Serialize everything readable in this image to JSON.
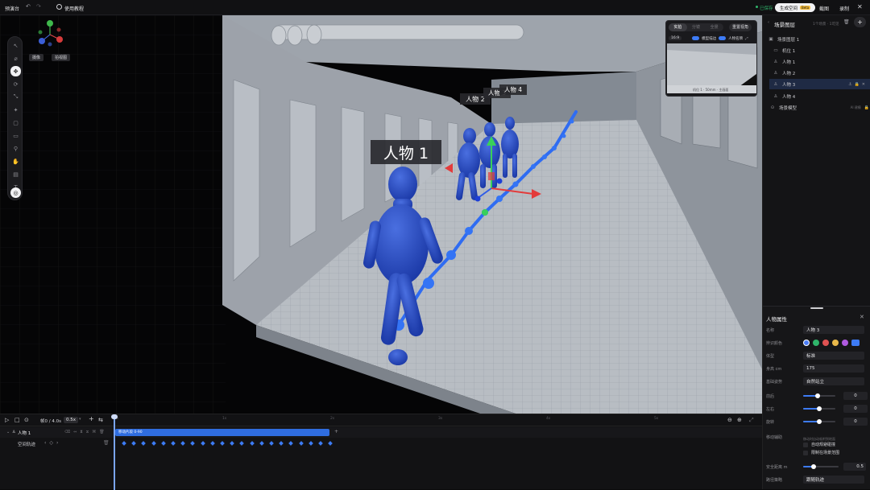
{
  "topbar": {
    "title": "预演台",
    "tutorial": "使用教程",
    "saved": "已保存",
    "gen_space": "生成空间",
    "beta": "Beta",
    "screenshot": "截图",
    "record": "录制"
  },
  "viewport": {
    "view_buttons": {
      "camera": "摄像",
      "rotate": "拍视图"
    },
    "labels": [
      "人物 1",
      "人物 2",
      "人物 3",
      "人物 4"
    ],
    "preview": {
      "tabs": [
        "实拍",
        "分镜",
        "全景"
      ],
      "reset_view": "重置视角",
      "ratio": "16:9",
      "toggle_model": "模型描边",
      "toggle_names": "人物名牌",
      "caption": "机位 1 · 50mm · 主画面"
    }
  },
  "scene": {
    "title": "场景图层",
    "count": "1个场景 · 1可见",
    "items": [
      {
        "icon": "layers",
        "label": "场景图层 1"
      },
      {
        "icon": "camera",
        "label": "机位 1"
      },
      {
        "icon": "person",
        "label": "人物 1"
      },
      {
        "icon": "person",
        "label": "人物 2"
      },
      {
        "icon": "person",
        "label": "人物 3"
      },
      {
        "icon": "person",
        "label": "人物 4"
      },
      {
        "icon": "model",
        "label": "场景模型",
        "tag": "AI 建模"
      }
    ]
  },
  "props": {
    "title": "人物属性",
    "name_label": "名称",
    "name_value": "人物 3",
    "color_label": "辨识颜色",
    "colors": [
      "#4a7cf5",
      "#2fb46a",
      "#e05252",
      "#e8b84a",
      "#b05ae0",
      "#3d7bf5"
    ],
    "body_label": "体型",
    "body_value": "标准",
    "height_label": "身高 cm",
    "height_value": "175",
    "pose_label": "基础姿势",
    "pose_value": "自然站立",
    "sliders": [
      {
        "label": "前后",
        "value": "0",
        "level": 0.45
      },
      {
        "label": "左右",
        "value": "0",
        "level": 0.5
      },
      {
        "label": "旋转",
        "value": "0",
        "level": 0.5
      }
    ],
    "motion_label": "移动辅助",
    "motion_hint": "移动时自动吸附到地面",
    "opt1": "自动规避碰撞",
    "opt2": "限制在场景范围",
    "safe_label": "安全距离 m",
    "safe_value": "0.5",
    "safe_level": 0.3,
    "path_label": "路径策略",
    "path_value": "跟随轨迹"
  },
  "timeline": {
    "frame": "帧0 / 4.0s",
    "speed": "0.5x",
    "ticks": [
      "0s",
      "1s",
      "2s",
      "3s",
      "4s",
      "5s"
    ],
    "track1": "人物 1",
    "track2": "空间轨迹",
    "clip": "移动片段 0-90"
  }
}
